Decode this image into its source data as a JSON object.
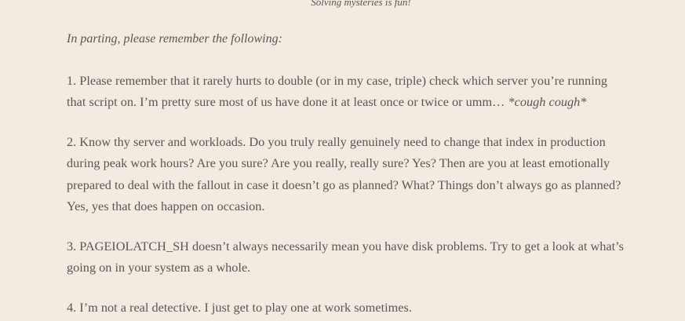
{
  "caption": "Solving mysteries is fun!",
  "intro": "In parting, please remember the following:",
  "items": [
    {
      "lines": [
        "1. Please remember that it rarely hurts to double (or in my case, triple) check which server you’re running",
        "that script on. I’m pretty sure most of us have done it at least once or twice or umm… "
      ],
      "aside": "*cough cough*"
    },
    {
      "lines": [
        "2. Know thy server and workloads. Do you truly really genuinely need to change that index in production",
        "during peak work hours? Are you sure? Are you really, really sure? Yes? Then are you at least emotionally",
        "prepared to deal with the fallout in case it doesn’t go as planned? What? Things don’t always go as planned?",
        "Yes, yes that does happen on occasion."
      ]
    },
    {
      "lines": [
        "3. PAGEIOLATCH_SH doesn’t always necessarily mean you have disk problems. Try to get a look at what’s",
        "going on in your system as a whole."
      ]
    },
    {
      "lines": [
        "4. I’m not a real detective. I just get to play one at work sometimes."
      ]
    }
  ]
}
